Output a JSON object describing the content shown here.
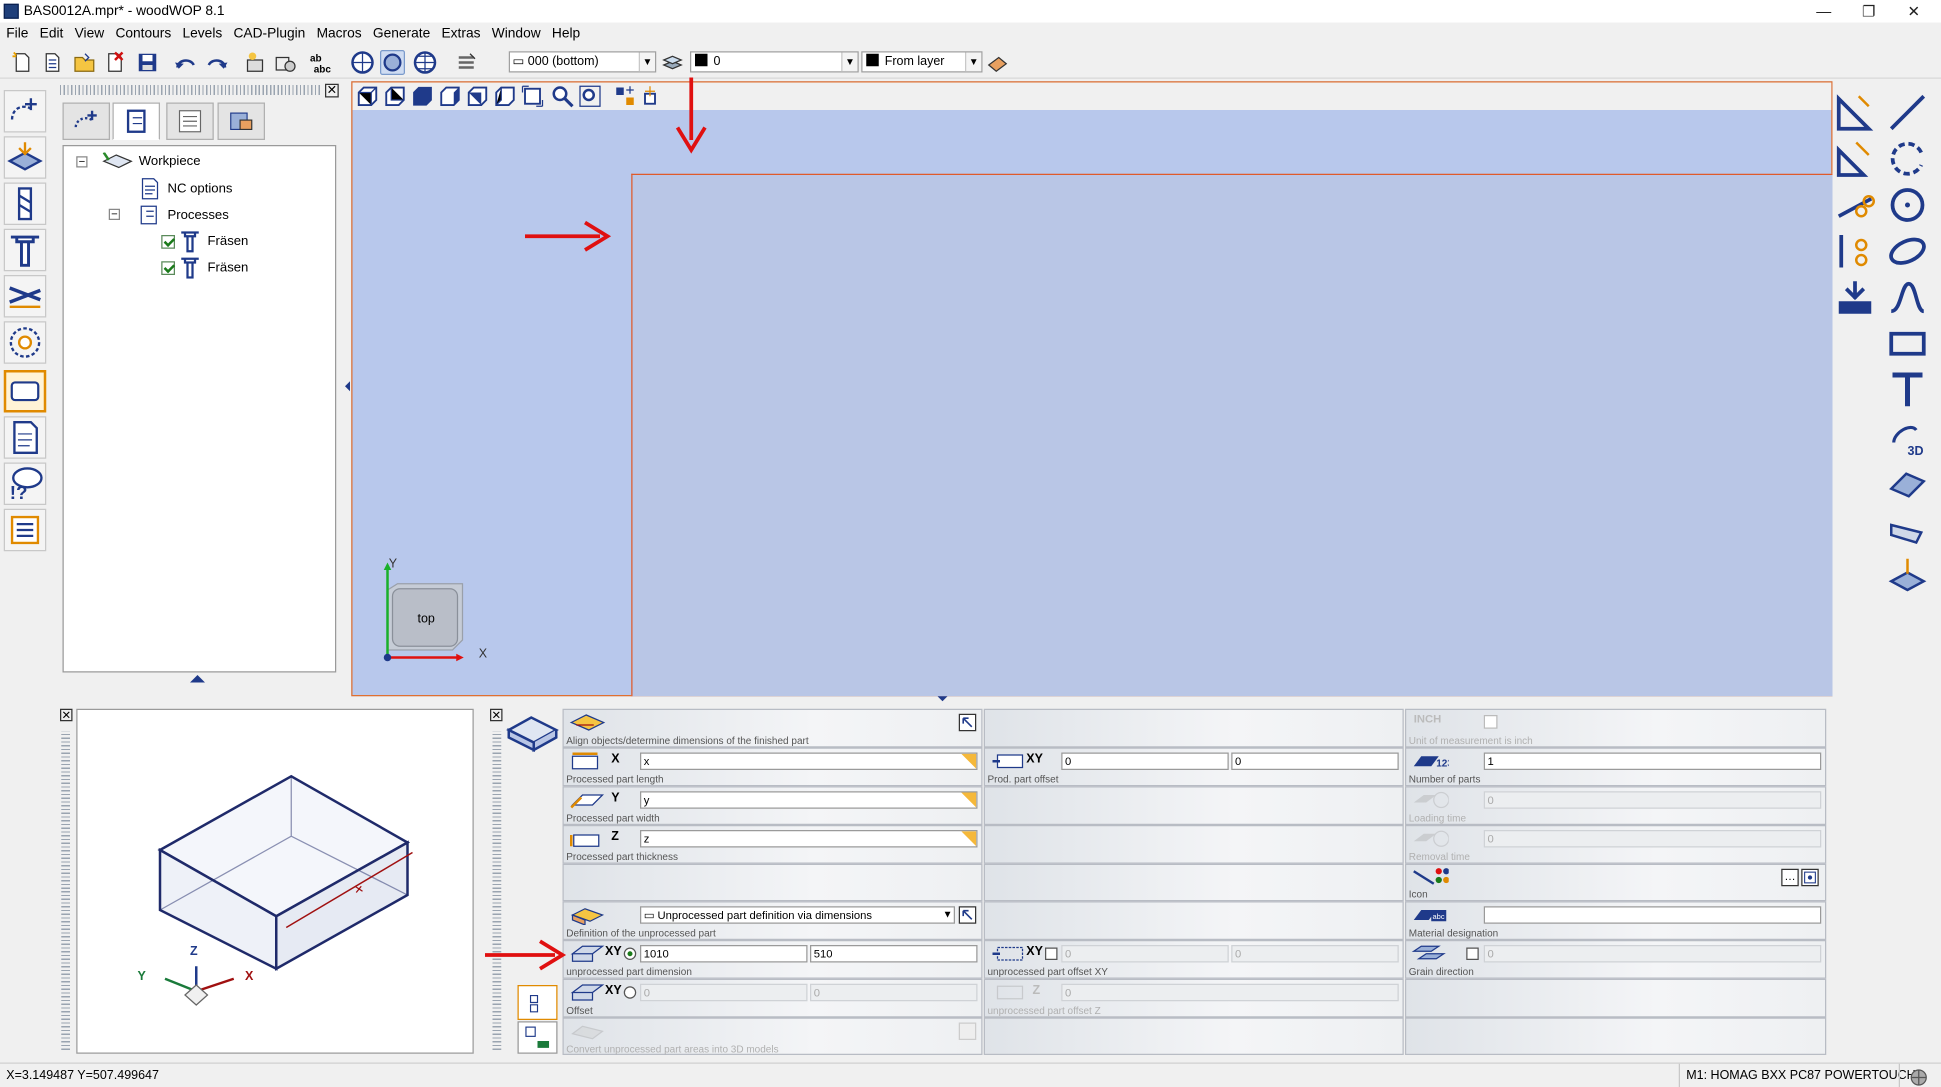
{
  "window": {
    "title": "BAS0012A.mpr* - woodWOP 8.1",
    "minimize": "—",
    "restore": "❐",
    "close": "✕"
  },
  "menu": [
    "File",
    "Edit",
    "View",
    "Contours",
    "Levels",
    "CAD-Plugin",
    "Macros",
    "Generate",
    "Extras",
    "Window",
    "Help"
  ],
  "toolbar": {
    "level_combo": "000  (bottom)",
    "color_combo": "0",
    "layer_combo": "From layer"
  },
  "tree": {
    "root": "Workpiece",
    "nc_options": "NC options",
    "processes": "Processes",
    "process_items": [
      "Fräsen",
      "Fräsen"
    ]
  },
  "viewport": {
    "view_cube_label": "top",
    "axis_x": "X",
    "axis_y": "Y"
  },
  "iso_view": {
    "axis_x": "X",
    "axis_y": "Y",
    "axis_z": "Z"
  },
  "properties": {
    "align_label": "Align objects/determine dimensions of the finished part",
    "unit_label": "Unit of measurement is inch",
    "unit_tag": "INCH",
    "x_axis": "X",
    "x_value": "x",
    "x_label": "Processed part length",
    "prod_offset_axis": "XY",
    "prod_offset_x": "0",
    "prod_offset_y": "0",
    "prod_offset_label": "Prod. part offset",
    "number_of_parts_value": "1",
    "number_of_parts_label": "Number of parts",
    "y_axis": "Y",
    "y_value": "y",
    "y_label": "Processed part width",
    "loading_time_value": "0",
    "loading_time_label": "Loading time",
    "z_axis": "Z",
    "z_value": "z",
    "z_label": "Processed part thickness",
    "removal_time_value": "0",
    "removal_time_label": "Removal time",
    "icon_label": "Icon",
    "definition_value": "Unprocessed part definition via dimensions",
    "definition_label": "Definition of the unprocessed part",
    "material_label": "Material designation",
    "material_value": "",
    "unproc_dim_axis": "XY",
    "unproc_dim_x": "1010",
    "unproc_dim_y": "510",
    "unproc_dim_label": "unprocessed part dimension",
    "unproc_offset_axis": "XY",
    "unproc_offset_x": "0",
    "unproc_offset_y": "0",
    "unproc_offset_label": "unprocessed part offset XY",
    "grain_value": "0",
    "grain_label": "Grain direction",
    "offset_axis": "XY",
    "offset_x": "0",
    "offset_y": "0",
    "offset_label": "Offset",
    "offset_z_axis": "Z",
    "offset_z_value": "0",
    "offset_z_label": "unprocessed part offset Z",
    "convert_label": "Convert unprocessed part areas into 3D models"
  },
  "status": {
    "coords": "X=3.149487 Y=507.499647",
    "machine": "M1: HOMAG BXX PC87 POWERTOUCH"
  },
  "colors": {
    "viewport_bg": "#b8c8ec",
    "workpiece_border": "#e05a2a",
    "annotation_arrow": "#e01010",
    "icon_blue": "#1f3a8a"
  }
}
